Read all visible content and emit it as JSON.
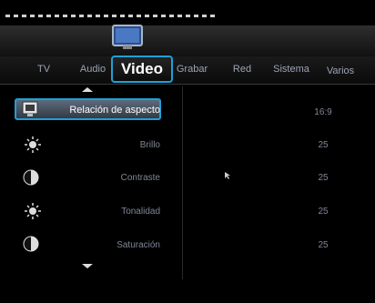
{
  "tabs": [
    {
      "label": "TV"
    },
    {
      "label": "Audio"
    },
    {
      "label": "Video"
    },
    {
      "label": "Grabar"
    },
    {
      "label": "Red"
    },
    {
      "label": "Sistema"
    },
    {
      "label": "Varios"
    }
  ],
  "settings": [
    {
      "label": "Relación de aspecto",
      "value": "16:9",
      "icon": "tv-icon"
    },
    {
      "label": "Brillo",
      "value": "25",
      "icon": "brightness-icon"
    },
    {
      "label": "Contraste",
      "value": "25",
      "icon": "contrast-icon"
    },
    {
      "label": "Tonalidad",
      "value": "25",
      "icon": "brightness-icon"
    },
    {
      "label": "Saturación",
      "value": "25",
      "icon": "contrast-icon"
    }
  ],
  "colors": {
    "accent": "#1fa0d8",
    "text_dim": "#7f8796"
  }
}
